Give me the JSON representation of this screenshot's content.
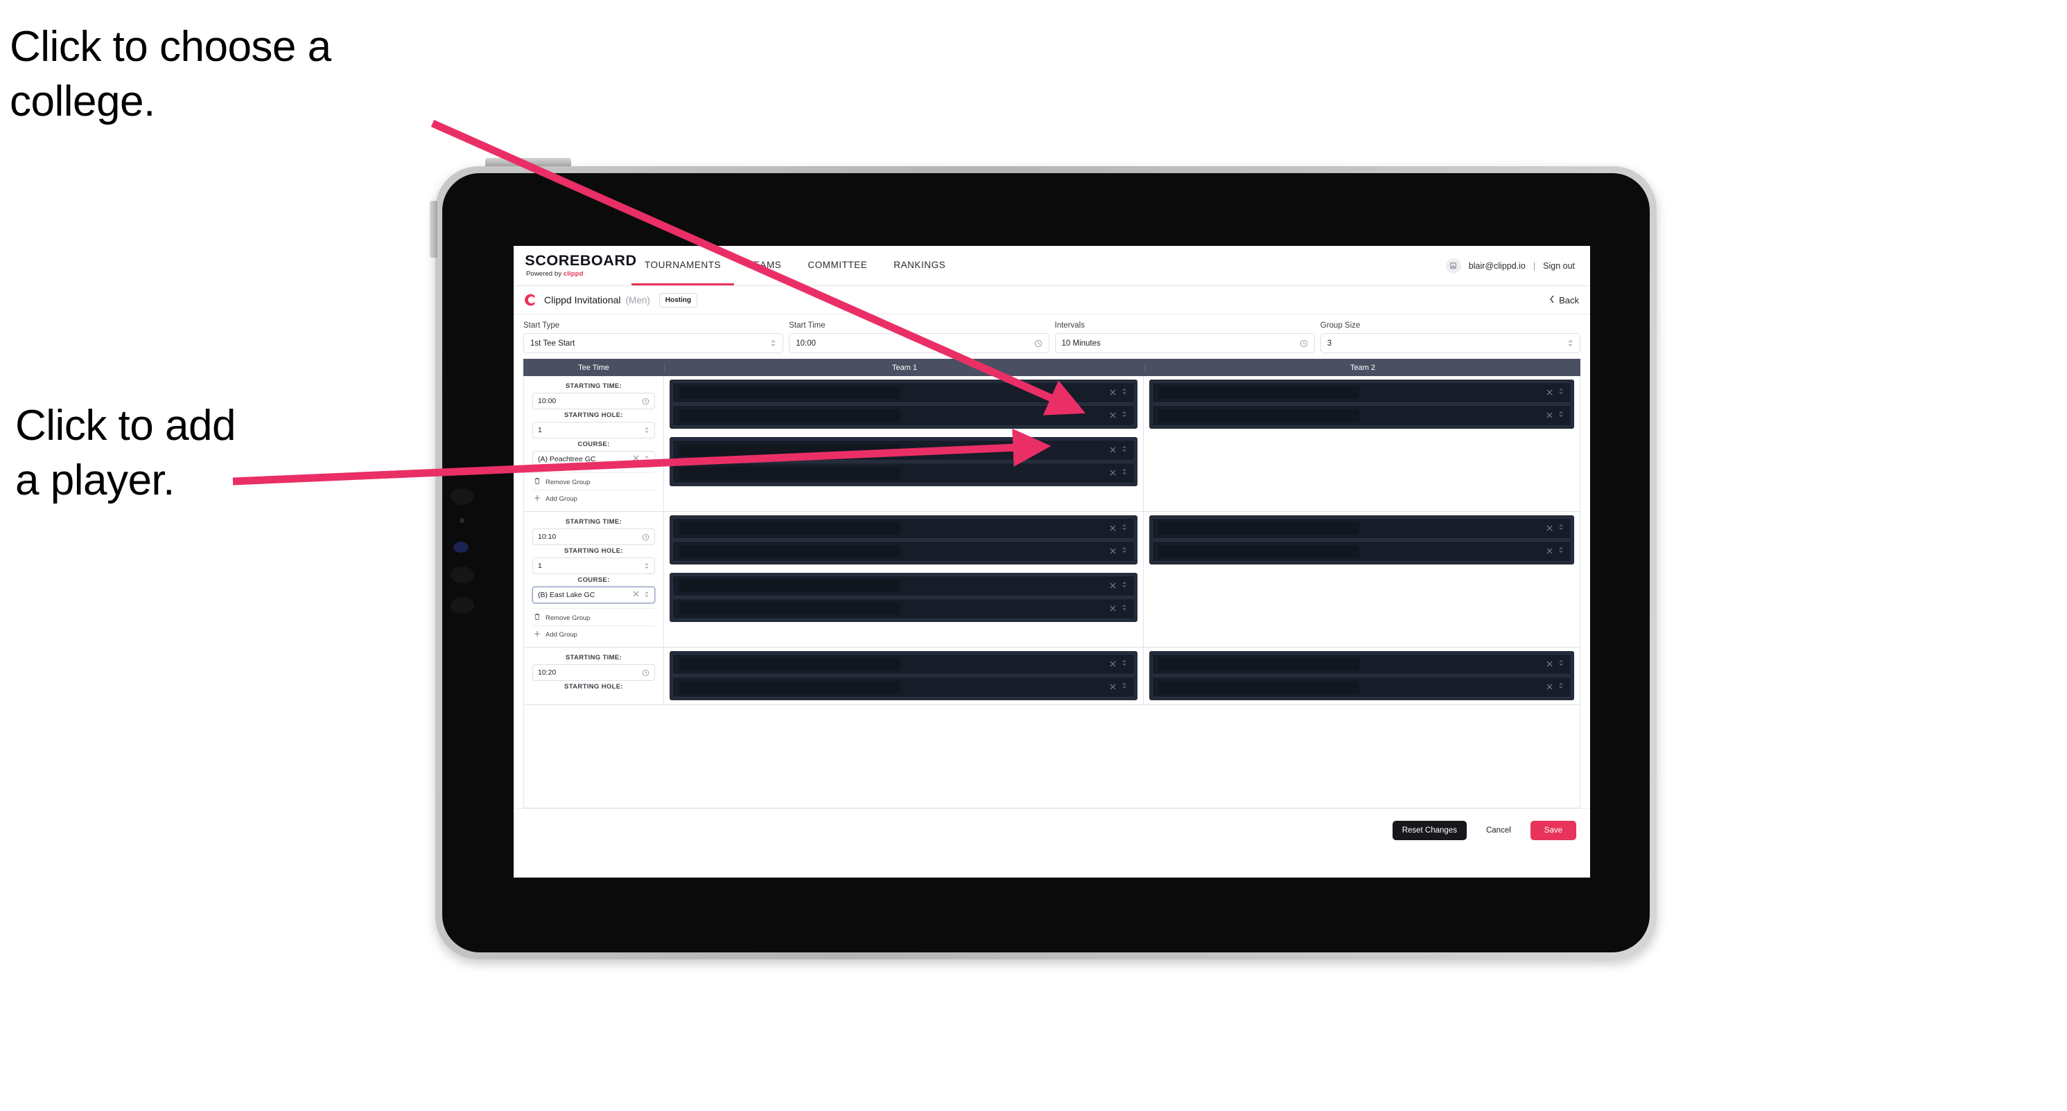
{
  "annotations": {
    "choose_college": "Click to choose a\ncollege.",
    "add_player": "Click to add\na player."
  },
  "colors": {
    "accent": "#e8335a",
    "annotation_arrow": "#ea2f66",
    "table_header_bg": "#4a5061",
    "player_row_bg": "#161c28",
    "save_button_bg": "#e8335a",
    "reset_button_bg": "#18181c"
  },
  "header": {
    "logo_word": "SCOREBOARD",
    "logo_sub_prefix": "Powered by ",
    "logo_sub_brand": "clippd",
    "nav": [
      {
        "label": "TOURNAMENTS",
        "active": true
      },
      {
        "label": "TEAMS",
        "active": false
      },
      {
        "label": "COMMITTEE",
        "active": false
      },
      {
        "label": "RANKINGS",
        "active": false
      }
    ],
    "avatar_icon": "user-avatar-icon",
    "user_email": "blair@clippd.io",
    "separator": "|",
    "sign_out": "Sign out"
  },
  "tournament": {
    "logo_icon": "clippd-c-logo-icon",
    "name": "Clippd Invitational",
    "gender": "(Men)",
    "badge": "Hosting",
    "back_icon": "chevron-left-icon",
    "back_label": "Back"
  },
  "settings": {
    "fields": [
      {
        "label": "Start Type",
        "value": "1st Tee Start",
        "icon": "chevron-updown-icon",
        "name": "start-type-select"
      },
      {
        "label": "Start Time",
        "value": "10:00",
        "icon": "clock-icon",
        "name": "start-time-input"
      },
      {
        "label": "Intervals",
        "value": "10 Minutes",
        "icon": "clock-icon",
        "name": "intervals-input"
      },
      {
        "label": "Group Size",
        "value": "3",
        "icon": "chevron-updown-icon",
        "name": "group-size-select"
      }
    ]
  },
  "grid": {
    "columns": [
      "Tee Time",
      "Team 1",
      "Team 2"
    ],
    "labels": {
      "starting_time": "STARTING TIME:",
      "starting_hole": "STARTING HOLE:",
      "course": "COURSE:",
      "remove_group": "Remove Group",
      "add_group": "Add Group",
      "trash_icon": "trash-icon",
      "plus_icon": "plus-icon",
      "clock_icon": "clock-icon",
      "stepper_icon": "chevron-updown-icon",
      "clear_icon": "close-x-icon"
    },
    "groups": [
      {
        "starting_time": "10:00",
        "starting_hole": "1",
        "course": "(A) Peachtree GC",
        "course_focused": false,
        "team1_blocks": [
          2,
          2
        ],
        "team2_blocks": [
          2
        ]
      },
      {
        "starting_time": "10:10",
        "starting_hole": "1",
        "course": "(B) East Lake GC",
        "course_focused": true,
        "team1_blocks": [
          2,
          2
        ],
        "team2_blocks": [
          2
        ]
      },
      {
        "starting_time": "10:20",
        "starting_hole": "",
        "course": "",
        "course_focused": false,
        "team1_blocks": [
          2
        ],
        "team2_blocks": [
          2
        ]
      }
    ]
  },
  "footer": {
    "reset_label": "Reset Changes",
    "cancel_label": "Cancel",
    "save_label": "Save"
  }
}
